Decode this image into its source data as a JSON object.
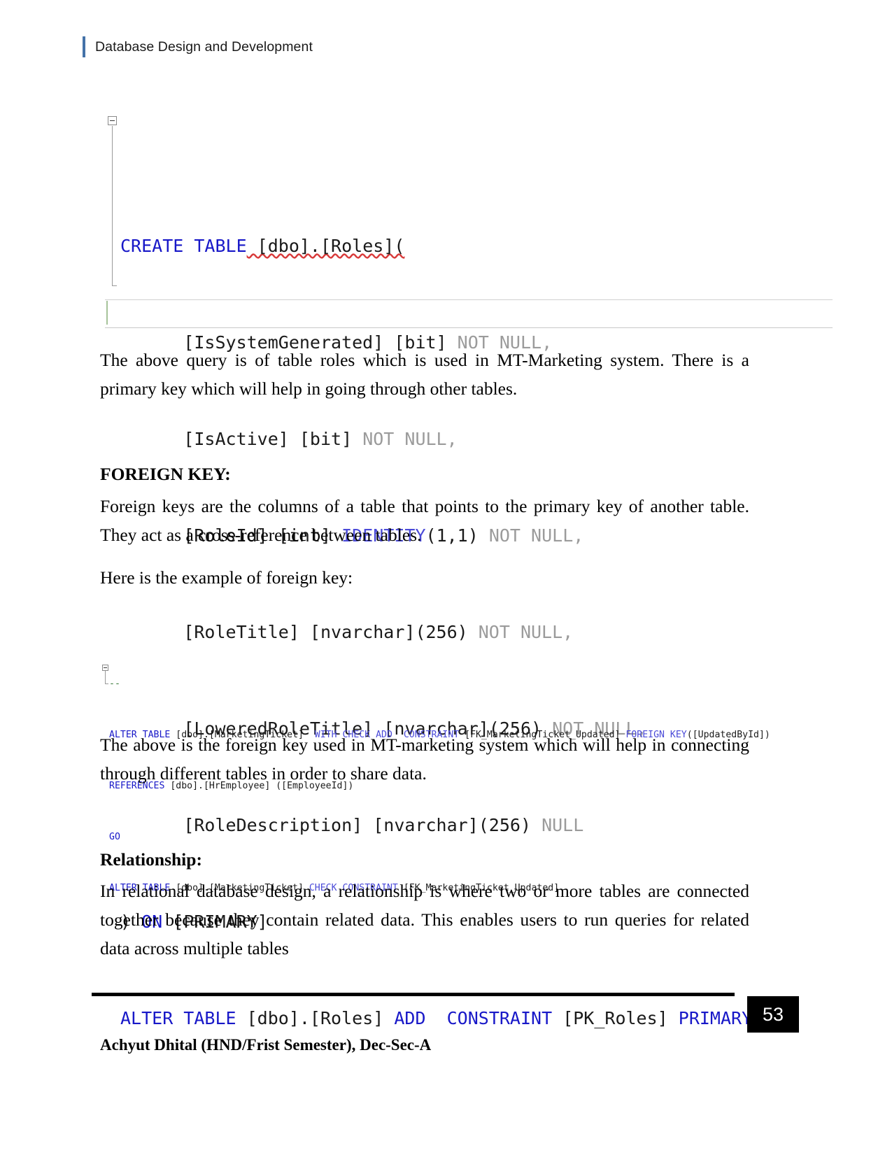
{
  "header": {
    "title": "Database Design and Development",
    "accent_color": "#4472a8"
  },
  "code_block_primary": {
    "caption_name": "create-table-roles-sql",
    "clipped_first_line": "GO",
    "lines": [
      "CREATE TABLE [dbo].[Roles](",
      "    [IsSystemGenerated] [bit] NOT NULL,",
      "    [IsActive] [bit] NOT NULL,",
      "    [RoleId] [int] IDENTITY(1,1) NOT NULL,",
      "    [RoleTitle] [nvarchar](256) NOT NULL,",
      "    [LoweredRoleTitle] [nvarchar](256) NOT NULL,",
      "    [RoleDescription] [nvarchar](256) NULL",
      ") ON [PRIMARY]",
      "ALTER TABLE [dbo].[Roles] ADD  CONSTRAINT [PK_Roles] PRIMARY KEY"
    ],
    "tokens": {
      "l1_kw": "CREATE TABLE",
      "l1_ident": " [dbo].[Roles](",
      "l2_ident": "[IsSystemGenerated] [bit]",
      "l2_gray": " NOT NULL,",
      "l3_ident": "[IsActive] [bit]",
      "l3_gray": " NOT NULL,",
      "l4_ident": "[RoleId] [int] ",
      "l4_kw": "IDENTITY",
      "l4_paren": "(1,1)",
      "l4_gray": " NOT NULL,",
      "l5_ident": "[RoleTitle] [nvarchar](256)",
      "l5_gray": " NOT NULL,",
      "l6_ident": "[LoweredRoleTitle] [nvarchar](256)",
      "l6_gray": " NOT NULL,",
      "l7_ident": "[RoleDescription] [nvarchar](256)",
      "l7_gray": " NULL",
      "l8_paren": ") ",
      "l8_kw": "ON",
      "l8_ident": " [PRIMARY]",
      "l9_kw_a": "ALTER TABLE",
      "l9_ident_a": " [dbo].[Roles] ",
      "l9_kw_b": "ADD  CONSTRAINT",
      "l9_ident_b": " [PK_Roles] ",
      "l9_kw_c": "PRIMARY KEY"
    }
  },
  "code_block_secondary": {
    "caption_name": "foreign-key-sql",
    "lines": [
      "--",
      "ALTER TABLE [dbo].[MarketingTicket]  WITH CHECK ADD  CONSTRAINT [FK_MarketingTicket_Updated] FOREIGN KEY([UpdatedById])",
      "REFERENCES [dbo].[HrEmployee] ([EmployeeId])",
      "GO",
      "ALTER TABLE [dbo].[MarketingTicket] CHECK CONSTRAINT [FK_MarketingTicket_Updated]"
    ],
    "tokens": {
      "comment": "--",
      "l2_kw_a": "ALTER TABLE",
      "l2_ident_a": " [dbo].[MarketingTicket]  ",
      "l2_kw_b": "WITH CHECK ADD",
      "l2_kw_c": "  CONSTRAINT",
      "l2_ident_b": " [FK_MarketingTicket_Updated] ",
      "l2_kw_d": "FOREIGN KEY",
      "l2_ident_c": "([UpdatedById])",
      "l3_kw": "REFERENCES",
      "l3_ident": " [dbo].[HrEmployee] ([EmployeeId])",
      "l4_kw": "GO",
      "l5_kw_a": "ALTER TABLE",
      "l5_ident_a": " [dbo].[MarketingTicket] ",
      "l5_kw_b": "CHECK CONSTRAINT",
      "l5_ident_b": " [FK_MarketingTicket_Updated]"
    }
  },
  "body": {
    "paragraph_after_primary_code": "The above query is of table roles which is used in MT-Marketing system. There is a primary key which will help in going through other tables.",
    "foreign_key_heading": "FOREIGN KEY:",
    "foreign_key_paragraph": "Foreign keys are the columns of a table that points to the primary key of another table. They act as a cross-reference between tables.",
    "foreign_key_example_lead": "Here is the example of foreign key:",
    "paragraph_after_secondary_code": "The above is the foreign key used in MT-marketing system which will help in connecting through different tables in order to share data.",
    "relationship_heading": "Relationship:",
    "relationship_paragraph": "In relational database design, a relationship is where two or more tables are connected together because they contain related data. This enables users to run queries for related data across multiple tables"
  },
  "footer": {
    "page_number": "53",
    "note": "Achyut Dhital (HND/Frist Semester), Dec-Sec-A"
  }
}
